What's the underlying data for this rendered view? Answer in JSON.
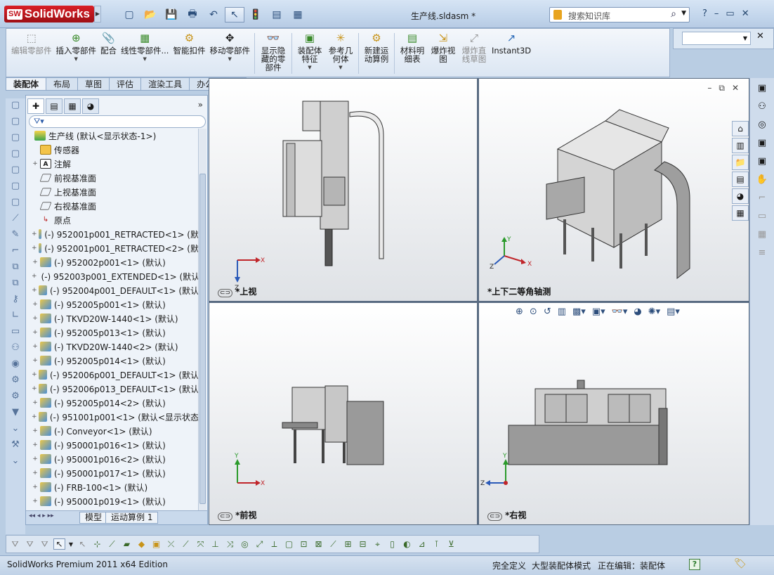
{
  "app": {
    "brand": "SolidWorks",
    "brand_badge": "SW",
    "document_title": "生产线.sldasm *"
  },
  "search": {
    "placeholder": "搜索知识库"
  },
  "ribbon": {
    "buttons": [
      {
        "label": "编辑零部件",
        "icon": "edit-component-icon",
        "enabled": false
      },
      {
        "label": "插入零部件",
        "icon": "insert-component-icon",
        "enabled": true
      },
      {
        "label": "配合",
        "icon": "mate-icon",
        "enabled": true
      },
      {
        "label": "线性零部件...",
        "icon": "linear-pattern-icon",
        "enabled": true
      },
      {
        "label": "智能扣件",
        "icon": "smart-fastener-icon",
        "enabled": true
      },
      {
        "label": "移动零部件",
        "icon": "move-component-icon",
        "enabled": true
      },
      {
        "label": "显示隐藏的零部件",
        "icon": "show-hidden-icon",
        "enabled": true
      },
      {
        "label": "装配体特征",
        "icon": "assembly-feature-icon",
        "enabled": true
      },
      {
        "label": "参考几何体",
        "icon": "reference-geometry-icon",
        "enabled": true
      },
      {
        "label": "新建运动算例",
        "icon": "new-motion-study-icon",
        "enabled": true
      },
      {
        "label": "材料明细表",
        "icon": "bom-icon",
        "enabled": true
      },
      {
        "label": "爆炸视图",
        "icon": "exploded-view-icon",
        "enabled": true
      },
      {
        "label": "爆炸直线草图",
        "icon": "explode-line-sketch-icon",
        "enabled": false
      },
      {
        "label": "Instant3D",
        "icon": "instant3d-icon",
        "enabled": true
      }
    ]
  },
  "cm_tabs": [
    "装配体",
    "布局",
    "草图",
    "评估",
    "渲染工具",
    "办公室产品"
  ],
  "tree": {
    "root": "生产线 (默认<显示状态-1>)",
    "items": [
      {
        "label": "传感器",
        "type": "sensor",
        "expand": ""
      },
      {
        "label": "注解",
        "type": "annotation",
        "expand": "+"
      },
      {
        "label": "前视基准面",
        "type": "plane",
        "expand": ""
      },
      {
        "label": "上视基准面",
        "type": "plane",
        "expand": ""
      },
      {
        "label": "右视基准面",
        "type": "plane",
        "expand": ""
      },
      {
        "label": "原点",
        "type": "origin",
        "expand": ""
      },
      {
        "label": "(-) 952001p001_RETRACTED<1> (默",
        "type": "part",
        "expand": "+"
      },
      {
        "label": "(-) 952001p001_RETRACTED<2> (默",
        "type": "part",
        "expand": "+"
      },
      {
        "label": "(-) 952002p001<1> (默认)",
        "type": "part",
        "expand": "+"
      },
      {
        "label": "(-) 952003p001_EXTENDED<1> (默认",
        "type": "part",
        "expand": "+"
      },
      {
        "label": "(-) 952004p001_DEFAULT<1> (默认",
        "type": "part",
        "expand": "+"
      },
      {
        "label": "(-) 952005p001<1> (默认)",
        "type": "part",
        "expand": "+"
      },
      {
        "label": "(-) TKVD20W-1440<1> (默认)",
        "type": "part",
        "expand": "+"
      },
      {
        "label": "(-) 952005p013<1> (默认)",
        "type": "part",
        "expand": "+"
      },
      {
        "label": "(-) TKVD20W-1440<2> (默认)",
        "type": "part",
        "expand": "+"
      },
      {
        "label": "(-) 952005p014<1> (默认)",
        "type": "part",
        "expand": "+"
      },
      {
        "label": "(-) 952006p001_DEFAULT<1> (默认",
        "type": "part",
        "expand": "+"
      },
      {
        "label": "(-) 952006p013_DEFAULT<1> (默认",
        "type": "part",
        "expand": "+"
      },
      {
        "label": "(-) 952005p014<2> (默认)",
        "type": "part",
        "expand": "+"
      },
      {
        "label": "(-) 951001p001<1> (默认<显示状态",
        "type": "part",
        "expand": "+"
      },
      {
        "label": "(-) Conveyor<1> (默认)",
        "type": "part",
        "expand": "+"
      },
      {
        "label": "(-) 950001p016<1> (默认)",
        "type": "part",
        "expand": "+"
      },
      {
        "label": "(-) 950001p016<2> (默认)",
        "type": "part",
        "expand": "+"
      },
      {
        "label": "(-) 950001p017<1> (默认)",
        "type": "part",
        "expand": "+"
      },
      {
        "label": "(-) FRB-100<1> (默认)",
        "type": "part",
        "expand": "+"
      },
      {
        "label": "(-) 950001p019<1> (默认)",
        "type": "part",
        "expand": "+"
      }
    ]
  },
  "bottom_tabs": {
    "model": "模型",
    "motion": "运动算例 1"
  },
  "views": {
    "top": "*上视",
    "iso": "*上下二等角轴测",
    "front": "*前视",
    "right": "*右视"
  },
  "axes": {
    "x": "X",
    "y": "Y",
    "z": "Z"
  },
  "status": {
    "edition": "SolidWorks Premium 2011 x64 Edition",
    "constraint": "完全定义",
    "mode": "大型装配体模式",
    "editing": "正在编辑：装配体",
    "help": "?"
  },
  "colors": {
    "accent": "#c1121a",
    "viewport_bg": "#ffffff",
    "gray_part": "#8a8a8a"
  }
}
